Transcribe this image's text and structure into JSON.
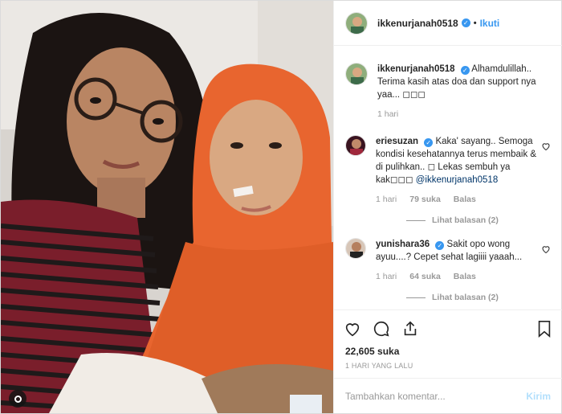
{
  "post": {
    "author": "ikkenurjanah0518",
    "follow_label": "Ikuti",
    "separator": "•",
    "verified_mark": "✓",
    "likes": "22,605 suka",
    "time_ago": "1 HARI YANG LALU"
  },
  "caption": {
    "user": "ikkenurjanah0518",
    "text": "Alhamdulillah.. Terima kasih atas doa dan support nya yaa... ◻◻◻",
    "time": "1 hari"
  },
  "comments": [
    {
      "user": "eriesuzan",
      "text": "Kaka' sayang.. Semoga kondisi kesehatannya terus membaik & di pulihkan.. ◻ Lekas sembuh ya kak◻◻◻",
      "mention": "@ikkenurjanah0518",
      "time": "1 hari",
      "likes": "79 suka",
      "reply": "Balas",
      "view_replies": "Lihat balasan (2)"
    },
    {
      "user": "yunishara36",
      "text": "Sakit opo wong ayuu....? Cepet sehat lagiiii yaaah...",
      "time": "1 hari",
      "likes": "64 suka",
      "reply": "Balas",
      "view_replies": "Lihat balasan (2)"
    }
  ],
  "composer": {
    "placeholder": "Tambahkan komentar...",
    "post_label": "Kirim"
  },
  "colors": {
    "accent": "#3897f0",
    "muted": "#999999",
    "hijab": "#e8652f",
    "shirt_stripe": "#7a1e2b"
  },
  "icons": [
    "heart-icon",
    "comment-icon",
    "share-icon",
    "bookmark-icon",
    "verified-icon",
    "more-options-icon"
  ]
}
